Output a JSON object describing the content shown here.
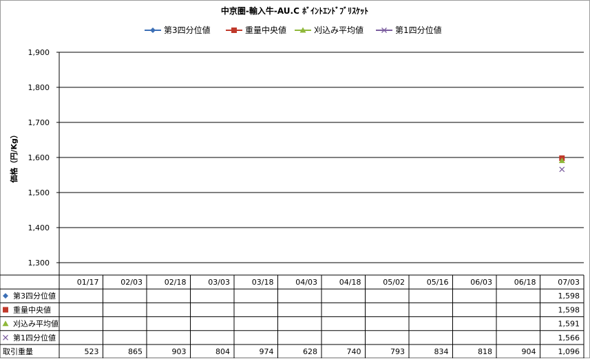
{
  "chart_data": {
    "type": "line",
    "title": "中京圏-輸入牛-AU.C ﾎﾞｲﾝﾄｴﾝﾄﾞﾌﾞﾘｽｹｯﾄ",
    "ylabel": "価格（円/Kg）",
    "xlabel": "",
    "categories": [
      "01/17",
      "02/03",
      "02/18",
      "03/03",
      "03/18",
      "04/03",
      "04/18",
      "05/02",
      "05/16",
      "06/03",
      "06/18",
      "07/03"
    ],
    "ylim": [
      1300,
      1900
    ],
    "ytick_labels": [
      "1,900",
      "1,800",
      "1,700",
      "1,600",
      "1,500",
      "1,400",
      "1,300"
    ],
    "ytick_values": [
      1900,
      1800,
      1700,
      1600,
      1500,
      1400,
      1300
    ],
    "grid": true,
    "legend_position": "top",
    "series": [
      {
        "name": "第3四分位値",
        "color": "#3c6fb6",
        "marker": "diamond",
        "values": [
          null,
          null,
          null,
          null,
          null,
          null,
          null,
          null,
          null,
          null,
          null,
          1598
        ],
        "display": [
          "",
          "",
          "",
          "",
          "",
          "",
          "",
          "",
          "",
          "",
          "",
          "1,598"
        ]
      },
      {
        "name": "重量中央値",
        "color": "#c0392b",
        "marker": "square",
        "values": [
          null,
          null,
          null,
          null,
          null,
          null,
          null,
          null,
          null,
          null,
          null,
          1598
        ],
        "display": [
          "",
          "",
          "",
          "",
          "",
          "",
          "",
          "",
          "",
          "",
          "",
          "1,598"
        ]
      },
      {
        "name": "刈込み平均値",
        "color": "#8fb83a",
        "marker": "triangle",
        "values": [
          null,
          null,
          null,
          null,
          null,
          null,
          null,
          null,
          null,
          null,
          null,
          1591
        ],
        "display": [
          "",
          "",
          "",
          "",
          "",
          "",
          "",
          "",
          "",
          "",
          "",
          "1,591"
        ]
      },
      {
        "name": "第1四分位値",
        "color": "#7a5c9e",
        "marker": "x",
        "values": [
          null,
          null,
          null,
          null,
          null,
          null,
          null,
          null,
          null,
          null,
          null,
          1566
        ],
        "display": [
          "",
          "",
          "",
          "",
          "",
          "",
          "",
          "",
          "",
          "",
          "",
          "1,566"
        ]
      }
    ],
    "volume_row": {
      "name": "取引重量",
      "values": [
        523,
        865,
        903,
        804,
        974,
        628,
        740,
        793,
        834,
        818,
        904,
        1096
      ],
      "display": [
        "523",
        "865",
        "903",
        "804",
        "974",
        "628",
        "740",
        "793",
        "834",
        "818",
        "904",
        "1,096"
      ]
    }
  }
}
